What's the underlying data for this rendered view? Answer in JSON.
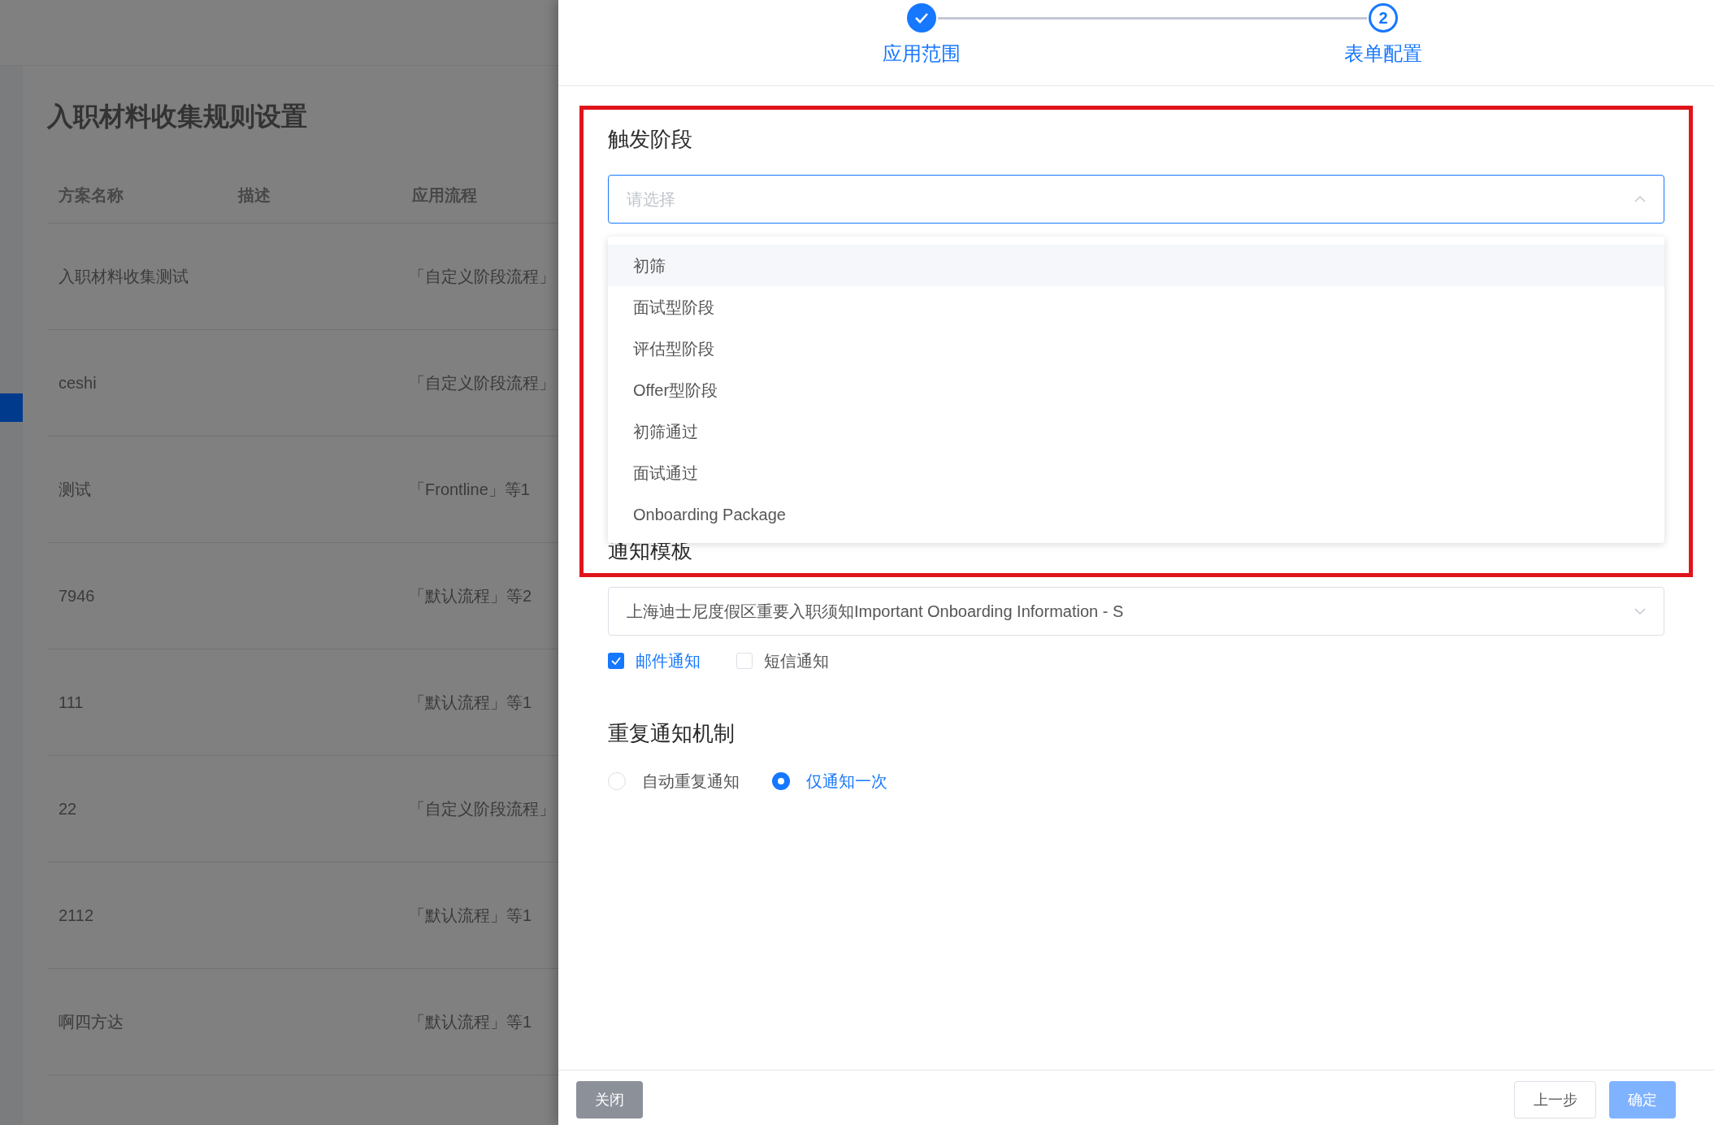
{
  "page": {
    "title": "入职材料收集规则设置",
    "table": {
      "columns": [
        "方案名称",
        "描述",
        "应用流程"
      ],
      "rows": [
        {
          "name": "入职材料收集测试",
          "flow": "「自定义阶段流程」"
        },
        {
          "name": "ceshi",
          "flow": "「自定义阶段流程」"
        },
        {
          "name": "测试",
          "flow": "「Frontline」等1"
        },
        {
          "name": "7946",
          "flow": "「默认流程」等2"
        },
        {
          "name": "111",
          "flow": "「默认流程」等1"
        },
        {
          "name": "22",
          "flow": "「自定义阶段流程」"
        },
        {
          "name": "2112",
          "flow": "「默认流程」等1"
        },
        {
          "name": "啊四方达",
          "flow": "「默认流程」等1"
        }
      ]
    }
  },
  "drawer": {
    "steps": [
      {
        "label": "应用范围",
        "done": true
      },
      {
        "label": "表单配置",
        "number": "2",
        "done": false
      }
    ],
    "trigger_stage": {
      "label": "触发阶段",
      "placeholder": "请选择",
      "open": true,
      "options": [
        {
          "label": "初筛",
          "hovered": true
        },
        {
          "label": "面试型阶段",
          "hovered": false
        },
        {
          "label": "评估型阶段",
          "hovered": false
        },
        {
          "label": "Offer型阶段",
          "hovered": false
        },
        {
          "label": "初筛通过",
          "hovered": false
        },
        {
          "label": "面试通过",
          "hovered": false
        },
        {
          "label": "Onboarding Package",
          "hovered": false
        }
      ]
    },
    "template": {
      "label": "通知模板",
      "value": "上海迪士尼度假区重要入职须知Important Onboarding Information - S"
    },
    "channels": [
      {
        "label": "邮件通知",
        "checked": true
      },
      {
        "label": "短信通知",
        "checked": false
      }
    ],
    "repeat": {
      "label": "重复通知机制",
      "options": [
        {
          "label": "自动重复通知",
          "selected": false
        },
        {
          "label": "仅通知一次",
          "selected": true
        }
      ]
    },
    "footer": {
      "close": "关闭",
      "prev": "上一步",
      "confirm": {
        "label": "确定",
        "disabled": true
      }
    }
  }
}
